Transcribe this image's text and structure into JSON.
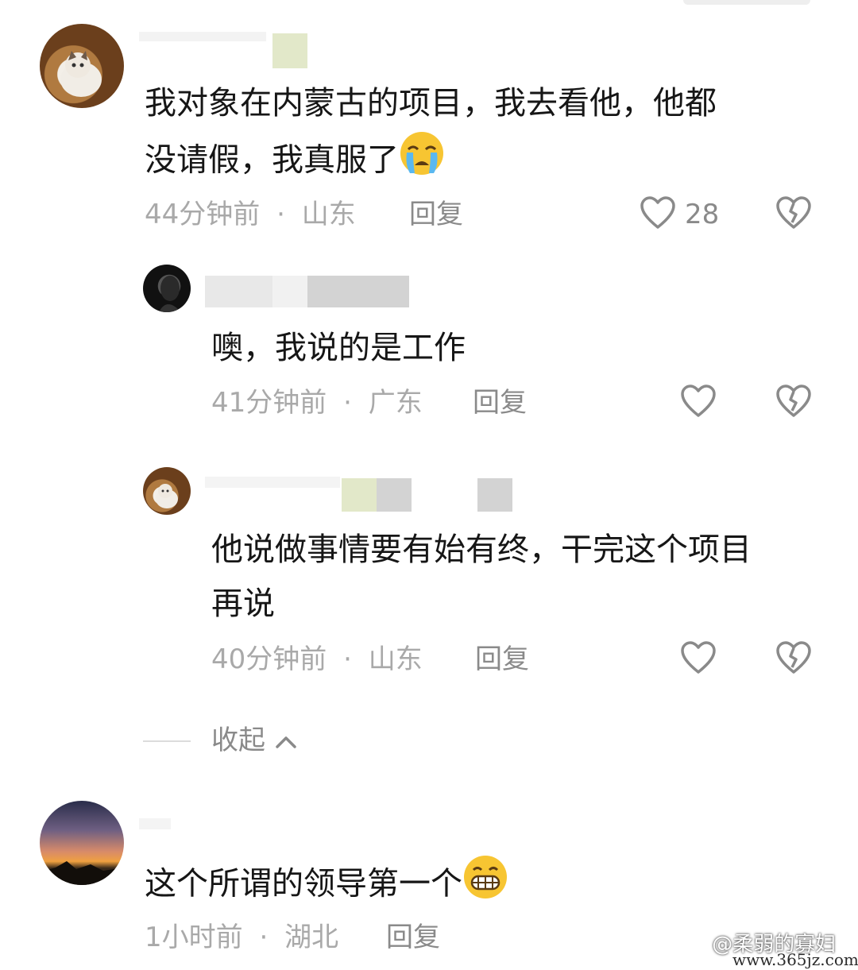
{
  "comments": [
    {
      "text_line1": "我对象在内蒙古的项目，我去看他，他都",
      "text_line2": "没请假，我真服了",
      "time": "44分钟前",
      "sep": "·",
      "location": "山东",
      "reply": "回复",
      "likes": "28",
      "emoji": "crying-face-icon"
    },
    {
      "text": "噢，我说的是工作",
      "time": "41分钟前",
      "sep": "·",
      "location": "广东",
      "reply": "回复"
    },
    {
      "text_line1": "他说做事情要有始有终，干完这个项目",
      "text_line2": "再说",
      "time": "40分钟前",
      "sep": "·",
      "location": "山东",
      "reply": "回复"
    }
  ],
  "collapse": {
    "label": "收起"
  },
  "last_comment": {
    "text": "这个所谓的领导第一个",
    "time": "1小时前",
    "sep": "·",
    "location": "湖北",
    "reply": "回复",
    "emoji": "grinning-face-icon"
  },
  "watermark": {
    "text": "@柔弱的寡妇",
    "url": "www.365jz.com"
  },
  "colors": {
    "text": "#161616",
    "meta": "#a9a9a9",
    "icon": "#8a8a8a"
  }
}
